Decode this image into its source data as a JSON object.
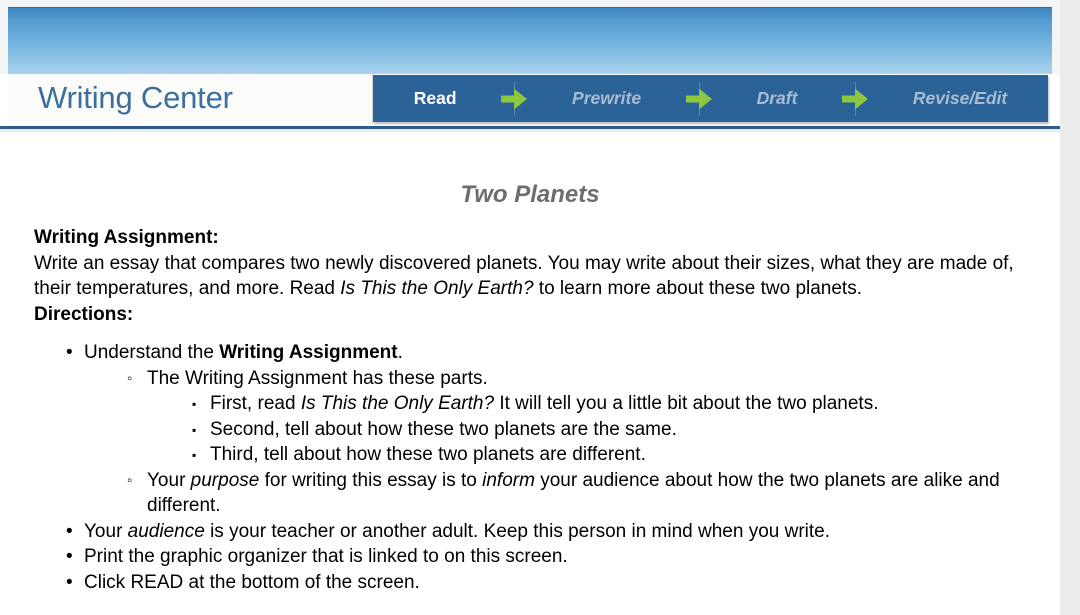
{
  "brand": {
    "title": "Writing Center"
  },
  "stepnav": {
    "steps": [
      {
        "label": "Read",
        "state": "active"
      },
      {
        "label": "Prewrite",
        "state": "inactive"
      },
      {
        "label": "Draft",
        "state": "inactive"
      },
      {
        "label": "Revise/Edit",
        "state": "inactive"
      }
    ],
    "separator_icon": "green-right-arrow-icon"
  },
  "colors": {
    "nav_bar": "#2b6298",
    "nav_active_text": "#ffffff",
    "nav_inactive_text": "#a7bcd3",
    "arrow_green": "#8dc63f",
    "brand_blue": "#3c6e9e",
    "banner_top": "#3f86c0",
    "banner_bottom": "#a9d2ec",
    "rule_blue": "#2e5c8a",
    "title_gray": "#6d6d6d",
    "page_background": "#ebebeb"
  },
  "document": {
    "title": "Two Planets",
    "assignment_heading": "Writing Assignment:",
    "assignment_text_1": "Write an essay that compares two newly discovered planets. You may write about their sizes, what they are made of, their temperatures, and more. Read ",
    "assignment_text_italic": "Is This the Only Earth?",
    "assignment_text_2": " to learn more about these two planets.",
    "directions_heading": "Directions:",
    "bullets": {
      "b1_pre": "Understand the ",
      "b1_bold": "Writing Assignment",
      "b1_post": ".",
      "b1_sub1": "The Writing Assignment has these parts.",
      "b1_sub1_items": [
        {
          "pre": "First, read ",
          "italic": "Is This the Only Earth?",
          "post": " It will tell you a little bit about the two planets."
        },
        {
          "pre": "Second, tell about how these two planets are the same.",
          "italic": "",
          "post": ""
        },
        {
          "pre": "Third, tell about how these two planets are different.",
          "italic": "",
          "post": ""
        }
      ],
      "b1_sub2_p1": "Your ",
      "b1_sub2_i1": "purpose",
      "b1_sub2_p2": " for writing this essay is to ",
      "b1_sub2_i2": "inform",
      "b1_sub2_p3": " your audience about how the two planets are alike and different.",
      "b2_p1": "Your ",
      "b2_i1": "audience",
      "b2_p2": " is your teacher or another adult. Keep this person in mind when you write.",
      "b3": "Print the graphic organizer that is linked to on this screen.",
      "b4": "Click READ at the bottom of the screen."
    },
    "markers": {
      "level1": "•",
      "level2": "◦",
      "level3": "▪"
    }
  }
}
